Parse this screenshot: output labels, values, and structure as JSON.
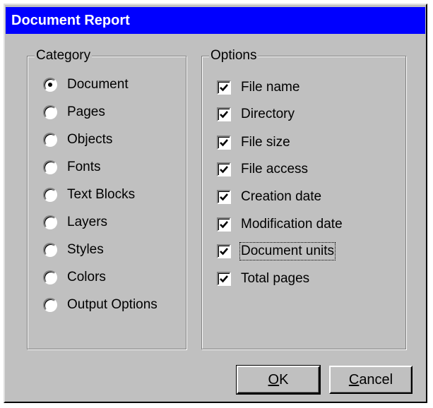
{
  "window": {
    "title": "Document Report"
  },
  "category": {
    "label": "Category",
    "options": [
      {
        "label": "Document",
        "selected": true
      },
      {
        "label": "Pages",
        "selected": false
      },
      {
        "label": "Objects",
        "selected": false
      },
      {
        "label": "Fonts",
        "selected": false
      },
      {
        "label": "Text Blocks",
        "selected": false
      },
      {
        "label": "Layers",
        "selected": false
      },
      {
        "label": "Styles",
        "selected": false
      },
      {
        "label": "Colors",
        "selected": false
      },
      {
        "label": "Output Options",
        "selected": false
      }
    ]
  },
  "options": {
    "label": "Options",
    "items": [
      {
        "label": "File name",
        "checked": true
      },
      {
        "label": "Directory",
        "checked": true
      },
      {
        "label": "File size",
        "checked": true
      },
      {
        "label": "File access",
        "checked": true
      },
      {
        "label": "Creation date",
        "checked": true
      },
      {
        "label": "Modification date",
        "checked": true
      },
      {
        "label": "Document units",
        "checked": true
      },
      {
        "label": "Total pages",
        "checked": true
      }
    ]
  },
  "buttons": {
    "ok": "OK",
    "cancel": "Cancel"
  }
}
